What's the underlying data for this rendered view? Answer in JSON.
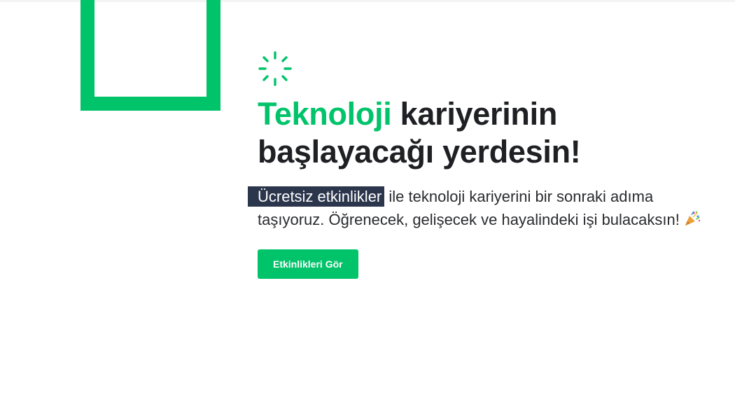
{
  "hero": {
    "icon": "sparkle-icon",
    "title_accent": "Teknoloji",
    "title_rest_line1": " kariyerinin",
    "title_line2": "başlayacağı yerdesin!",
    "desc_highlight": "Ücretsiz etkinlikler",
    "desc_rest": " ile teknoloji kariyerini bir sonraki adıma taşıyoruz. Öğrenecek, gelişecek ve hayalindeki işi bulacaksın!",
    "emoji_icon": "party-popper-icon",
    "cta_label": "Etkinlikleri Gör"
  },
  "colors": {
    "brand_green": "#00c36a",
    "highlight_bg": "#2b354b",
    "text_dark": "#1f2023"
  }
}
